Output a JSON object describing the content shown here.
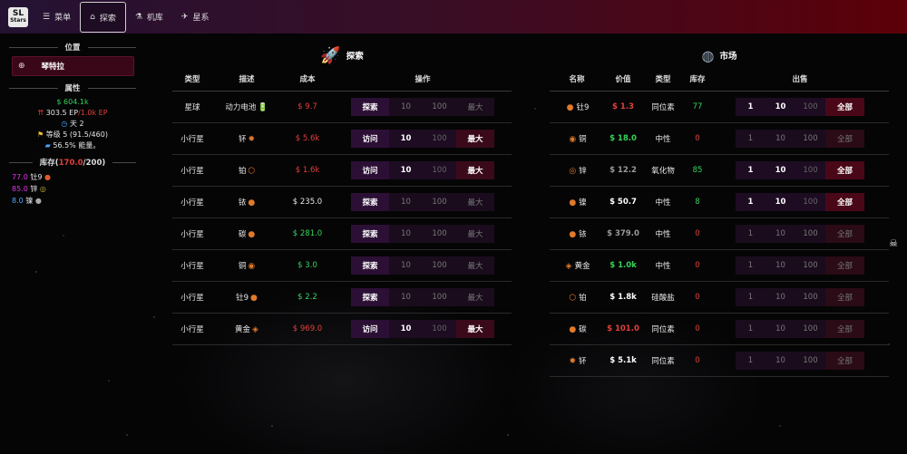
{
  "header": {
    "logo": {
      "line1": "SL",
      "line2": "Stars"
    },
    "nav": [
      {
        "icon": "menu-icon",
        "glyph": "☰",
        "label": "菜单",
        "active": false
      },
      {
        "icon": "home-icon",
        "glyph": "⌂",
        "label": "探索",
        "active": true
      },
      {
        "icon": "flask-icon",
        "glyph": "⚗",
        "label": "机库",
        "active": false
      },
      {
        "icon": "ship-icon",
        "glyph": "✈",
        "label": "星系",
        "active": false
      }
    ]
  },
  "sidebar": {
    "location_title": "位置",
    "location_name": "琴特拉",
    "attributes_title": "属性",
    "money": "$ 604.1k",
    "ep_current": "303.5 EP",
    "ep_max": "/1.0k EP",
    "days": "天 2",
    "level": "等级 5 (91.5/460)",
    "energy": "56.5% 能量。",
    "inventory_title_prefix": "库存(",
    "inventory_used": "170.0",
    "inventory_title_suffix": "/200)",
    "inventory": [
      {
        "amount": "77.0",
        "name": "钍9",
        "color": "#e033e6",
        "icon": "thorium-icon"
      },
      {
        "amount": "85.0",
        "name": "锌",
        "color": "#e033e6",
        "icon": "zinc-icon"
      },
      {
        "amount": "8.0",
        "name": "镍",
        "color": "#4aa9ff",
        "icon": "nickel-icon"
      }
    ]
  },
  "explore": {
    "title": "探索",
    "columns": [
      "类型",
      "描述",
      "成本",
      "操作"
    ],
    "rows": [
      {
        "type": "星球",
        "desc": "动力电池",
        "desc_glyph": "🔋",
        "cost": "$ 9.7",
        "cost_color": "#e0403a",
        "action": "探索",
        "enabled": false,
        "q": [
          "10",
          "100",
          "最大"
        ]
      },
      {
        "type": "小行星",
        "desc": "钚",
        "desc_glyph": "✹",
        "cost": "$ 5.6k",
        "cost_color": "#e0403a",
        "action": "访问",
        "enabled": true,
        "q": [
          "10",
          "100",
          "最大"
        ]
      },
      {
        "type": "小行星",
        "desc": "铂",
        "desc_glyph": "⬡",
        "cost": "$ 1.6k",
        "cost_color": "#e0403a",
        "action": "访问",
        "enabled": true,
        "q": [
          "10",
          "100",
          "最大"
        ]
      },
      {
        "type": "小行星",
        "desc": "铱",
        "desc_glyph": "●",
        "cost": "$ 235.0",
        "cost_color": "#e6e6e6",
        "action": "探索",
        "enabled": false,
        "q": [
          "10",
          "100",
          "最大"
        ]
      },
      {
        "type": "小行星",
        "desc": "碳",
        "desc_glyph": "●",
        "cost": "$ 281.0",
        "cost_color": "#35d35a",
        "action": "探索",
        "enabled": false,
        "q": [
          "10",
          "100",
          "最大"
        ]
      },
      {
        "type": "小行星",
        "desc": "铜",
        "desc_glyph": "◉",
        "cost": "$ 3.0",
        "cost_color": "#35d35a",
        "action": "探索",
        "enabled": false,
        "q": [
          "10",
          "100",
          "最大"
        ]
      },
      {
        "type": "小行星",
        "desc": "钍9",
        "desc_glyph": "●",
        "cost": "$ 2.2",
        "cost_color": "#35d35a",
        "action": "探索",
        "enabled": false,
        "q": [
          "10",
          "100",
          "最大"
        ]
      },
      {
        "type": "小行星",
        "desc": "黄金",
        "desc_glyph": "◈",
        "cost": "$ 969.0",
        "cost_color": "#e0403a",
        "action": "访问",
        "enabled": true,
        "q": [
          "10",
          "100",
          "最大"
        ]
      }
    ]
  },
  "market": {
    "title": "市场",
    "columns": [
      "名称",
      "价值",
      "类型",
      "库存",
      "出售"
    ],
    "rows": [
      {
        "name": "钍9",
        "glyph": "●",
        "value": "$ 1.3",
        "value_color": "#e0403a",
        "type": "同位素",
        "stock": "77",
        "stock_color": "#35d35a",
        "enabled": true,
        "q": [
          "1",
          "10",
          "100",
          "全部"
        ]
      },
      {
        "name": "铜",
        "glyph": "◉",
        "value": "$ 18.0",
        "value_color": "#35d35a",
        "type": "中性",
        "stock": "0",
        "stock_color": "#e0403a",
        "enabled": false,
        "q": [
          "1",
          "10",
          "100",
          "全部"
        ]
      },
      {
        "name": "锌",
        "glyph": "◎",
        "value": "$ 12.2",
        "value_color": "#9a9a9a",
        "type": "氧化物",
        "stock": "85",
        "stock_color": "#35d35a",
        "enabled": true,
        "q": [
          "1",
          "10",
          "100",
          "全部"
        ]
      },
      {
        "name": "镍",
        "glyph": "●",
        "value": "$ 50.7",
        "value_color": "#ffffff",
        "type": "中性",
        "stock": "8",
        "stock_color": "#35d35a",
        "enabled": true,
        "q": [
          "1",
          "10",
          "100",
          "全部"
        ]
      },
      {
        "name": "铱",
        "glyph": "●",
        "value": "$ 379.0",
        "value_color": "#9a9a9a",
        "type": "中性",
        "stock": "0",
        "stock_color": "#e0403a",
        "enabled": false,
        "q": [
          "1",
          "10",
          "100",
          "全部"
        ]
      },
      {
        "name": "黄金",
        "glyph": "◈",
        "value": "$ 1.0k",
        "value_color": "#35d35a",
        "type": "中性",
        "stock": "0",
        "stock_color": "#e0403a",
        "enabled": false,
        "q": [
          "1",
          "10",
          "100",
          "全部"
        ]
      },
      {
        "name": "铂",
        "glyph": "⬡",
        "value": "$ 1.8k",
        "value_color": "#ffffff",
        "type": "硅酸盐",
        "stock": "0",
        "stock_color": "#e0403a",
        "enabled": false,
        "q": [
          "1",
          "10",
          "100",
          "全部"
        ]
      },
      {
        "name": "碳",
        "glyph": "●",
        "value": "$ 101.0",
        "value_color": "#e0403a",
        "type": "同位素",
        "stock": "0",
        "stock_color": "#e0403a",
        "enabled": false,
        "q": [
          "1",
          "10",
          "100",
          "全部"
        ]
      },
      {
        "name": "钚",
        "glyph": "✹",
        "value": "$ 5.1k",
        "value_color": "#ffffff",
        "type": "同位素",
        "stock": "0",
        "stock_color": "#e0403a",
        "enabled": false,
        "q": [
          "1",
          "10",
          "100",
          "全部"
        ]
      }
    ]
  },
  "side_badge": "☠"
}
